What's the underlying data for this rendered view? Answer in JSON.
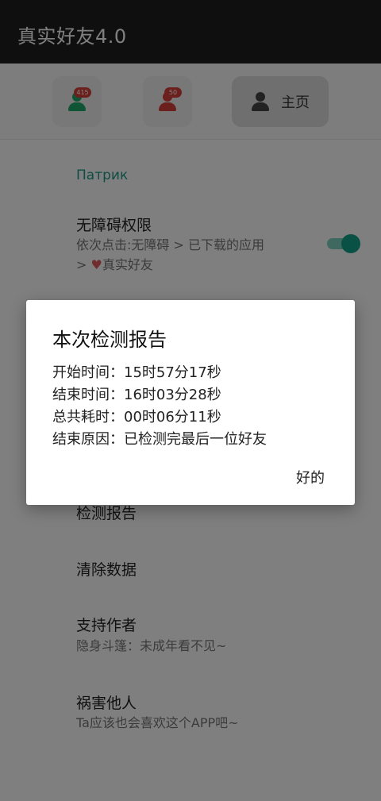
{
  "app": {
    "title": "真实好友4.0"
  },
  "tabs": {
    "badge_a": "415",
    "badge_b": "50",
    "home_label": "主页"
  },
  "colors": {
    "accent": "#13a389",
    "appbar": "#1e1e1e",
    "badge": "#d9403a",
    "green_icon": "#1ea86a",
    "red_icon": "#d9403a",
    "home_icon": "#444444"
  },
  "settings": {
    "section": "Патрик",
    "accessibility_title": "无障碍权限",
    "accessibility_sub_1": "依次点击:无障碍 > 已下载的应用",
    "accessibility_sub_2_prefix": "> ",
    "accessibility_sub_2_heart": "♥",
    "accessibility_sub_2_suffix": "真实好友",
    "accessibility_enabled": true,
    "report_title": "检测报告",
    "clear_title": "清除数据",
    "support_title": "支持作者",
    "support_sub": "隐身斗篷：未成年看不见~",
    "share_title": "祸害他人",
    "share_sub": "Ta应该也会喜欢这个APP吧~"
  },
  "dialog": {
    "title": "本次检测报告",
    "line1": "开始时间：15时57分17秒",
    "line2": "结束时间：16时03分28秒",
    "line3": "总共耗时：00时06分11秒",
    "line4": "结束原因：已检测完最后一位好友",
    "ok_label": "好的"
  }
}
